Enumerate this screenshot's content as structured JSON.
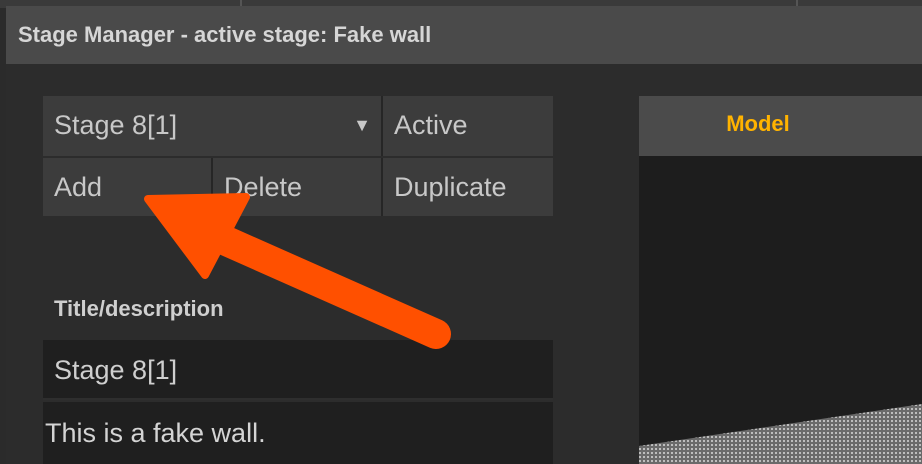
{
  "window": {
    "title": "Stage Manager - active stage: Fake wall"
  },
  "stage_controls": {
    "selected_stage": "Stage 8[1]",
    "active_label": "Active",
    "add_label": "Add",
    "delete_label": "Delete",
    "duplicate_label": "Duplicate"
  },
  "details": {
    "section_label": "Title/description",
    "title_value": "Stage 8[1]",
    "description_value": "This is a fake wall."
  },
  "viewport": {
    "tab_label": "Model"
  },
  "colors": {
    "accent": "#ffb300",
    "annotation_arrow": "#ff5000"
  },
  "icons": {
    "dropdown": "triangle-down-icon",
    "annotation": "arrow-annotation-icon"
  }
}
